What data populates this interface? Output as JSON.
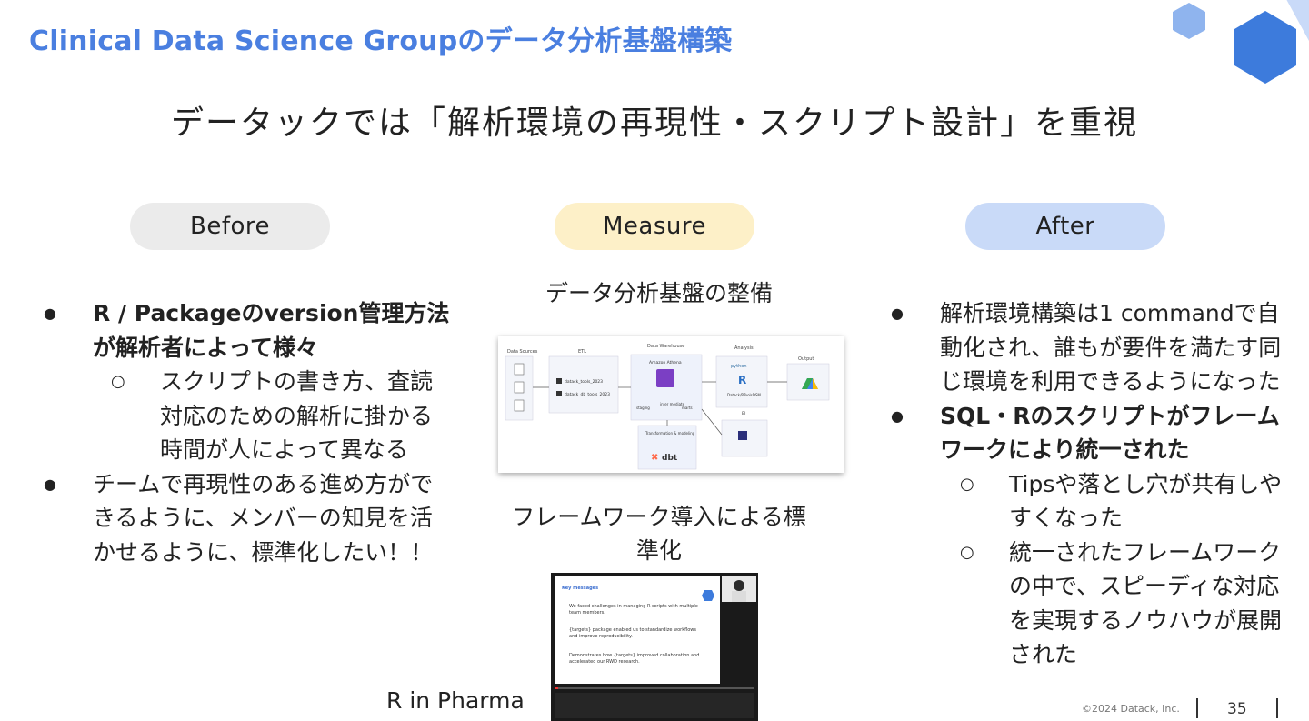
{
  "slide": {
    "title": "Clinical Data Science Groupのデータ分析基盤構築",
    "subtitle": "データックでは「解析環境の再現性・スクリプト設計」を重視"
  },
  "pills": {
    "before": "Before",
    "measure": "Measure",
    "after": "After"
  },
  "before": {
    "bullet1": "R / Packageのversion管理方法が解析者によって様々",
    "bullet1_sub1": "スクリプトの書き方、査読対応のための解析に掛かる時間が人によって異なる",
    "bullet2": "チームで再現性のある進め方ができるように、メンバーの知見を活かせるように、標準化したい！！"
  },
  "measure": {
    "label1": "データ分析基盤の整備",
    "label2": "フレームワーク導入による標準化",
    "video_caption": "R in Pharma",
    "diagram": {
      "sections": [
        "Data Sources",
        "ETL",
        "Data Warehouse",
        "Analysis",
        "Output"
      ],
      "etl_items": [
        "datack_tools_2023",
        "datack_db_tools_2023"
      ],
      "warehouse_title": "Amazon Athena",
      "warehouse_stages": [
        "staging",
        "inter mediate",
        "marts"
      ],
      "transform_label": "Transformation & modeling",
      "dbt_label": "dbt",
      "analysis_items": [
        "python",
        "R",
        "Datack/RToolsDSM"
      ],
      "bi_label": "BI"
    },
    "video": {
      "heading": "Key messages",
      "points": [
        "We faced challenges in managing R scripts with multiple team members.",
        "{targets} package enabled us to standardize workflows and improve reproducibility.",
        "Demonstrates how {targets} improved collaboration and accelerated our RWD research."
      ]
    }
  },
  "after": {
    "bullet1": "解析環境構築は1 commandで自動化され、誰もが要件を満たす同じ環境を利用できるようになった",
    "bullet2": "SQL・Rのスクリプトがフレームワークにより統一された",
    "bullet2_sub1": "Tipsや落とし穴が共有しやすくなった",
    "bullet2_sub2": "統一されたフレームワークの中で、スピーディな対応を実現するノウハウが展開された"
  },
  "footer": {
    "copyright": "©2024 Datack, Inc.",
    "page": "35"
  },
  "colors": {
    "title_blue": "#4a7fe0",
    "before_pill": "#ebebeb",
    "measure_pill": "#fdf0c8",
    "after_pill": "#c9daf8",
    "hex_dark": "#3d7bdc",
    "hex_light": "#8fb4ee"
  }
}
